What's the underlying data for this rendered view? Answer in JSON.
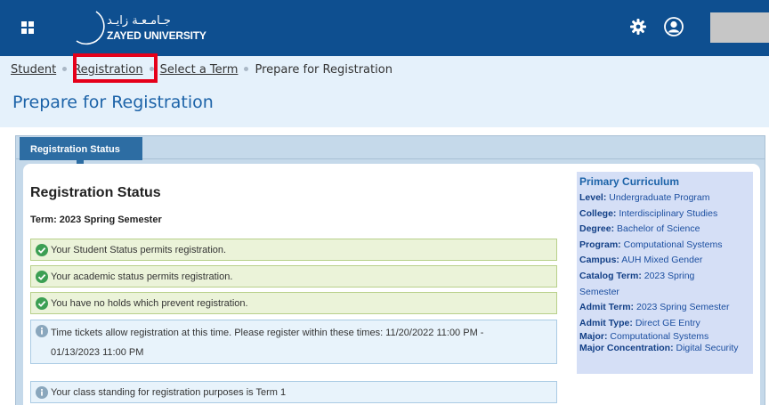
{
  "header": {
    "logo_arabic": "جـامـعـة زايـد",
    "logo_english": "ZAYED UNIVERSITY",
    "icons": [
      "grid-menu-icon",
      "gear-icon",
      "user-icon"
    ]
  },
  "breadcrumb": {
    "items": [
      "Student",
      "Registration",
      "Select a Term"
    ],
    "current": "Prepare for Registration"
  },
  "page_title": "Prepare for Registration",
  "tab": {
    "label": "Registration Status"
  },
  "status": {
    "heading": "Registration Status",
    "term": "Term: 2023 Spring Semester",
    "messages": [
      {
        "type": "ok",
        "text": "Your Student Status permits registration."
      },
      {
        "type": "ok",
        "text": "Your academic status permits registration."
      },
      {
        "type": "ok",
        "text": "You have no holds which prevent registration."
      },
      {
        "type": "info",
        "line1": "Time tickets allow registration at this time. Please register within these times: 11/20/2022 11:00 PM -",
        "line2": "01/13/2023 11:00 PM"
      },
      {
        "type": "info",
        "text": "Your class standing for registration purposes is Term 1"
      }
    ]
  },
  "curriculum": {
    "title": "Primary Curriculum",
    "rows": [
      {
        "label": "Level:",
        "value": "Undergraduate Program"
      },
      {
        "label": "College:",
        "value": "Interdisciplinary Studies"
      },
      {
        "label": "Degree:",
        "value": "Bachelor of Science"
      },
      {
        "label": "Program:",
        "value": "Computational Systems"
      },
      {
        "label": "Campus:",
        "value": "AUH Mixed Gender"
      },
      {
        "label": "Catalog Term:",
        "value": "2023 Spring",
        "value2": "Semester"
      },
      {
        "label": "Admit Term:",
        "value": "2023 Spring Semester"
      },
      {
        "label": "Admit Type:",
        "value": "Direct GE Entry"
      },
      {
        "label": "Major:",
        "value": "Computational Systems"
      },
      {
        "label": "Major Concentration:",
        "value": "Digital Security"
      }
    ]
  },
  "colors": {
    "topbar": "#0e4f90",
    "accent": "#1c63a8",
    "highlight_box": "#e5001a",
    "ok_bg": "#ebf3d9",
    "info_bg": "#e8f3fb",
    "curriculum_bg": "#d5dff6"
  }
}
